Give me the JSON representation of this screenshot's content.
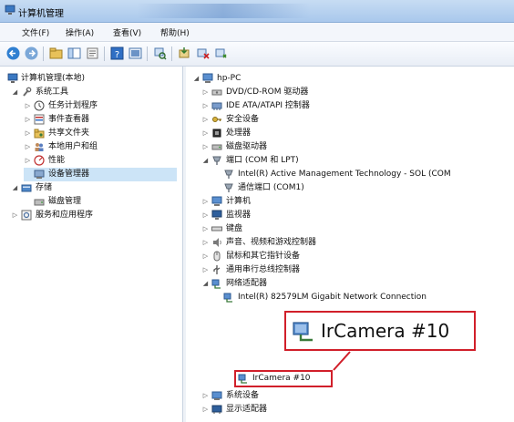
{
  "window": {
    "title": "计算机管理"
  },
  "menu": [
    {
      "label": "文件(F)"
    },
    {
      "label": "操作(A)"
    },
    {
      "label": "查看(V)"
    },
    {
      "label": "帮助(H)"
    }
  ],
  "toolbar": [
    {
      "icon": "back-arrow-icon"
    },
    {
      "icon": "forward-arrow-icon"
    },
    {
      "icon": "up-folder-icon"
    },
    {
      "icon": "show-tree-icon"
    },
    {
      "icon": "properties-icon"
    },
    {
      "icon": "help-icon"
    },
    {
      "icon": "console-icon"
    },
    {
      "icon": "scan-hardware-icon"
    },
    {
      "icon": "update-driver-icon"
    },
    {
      "icon": "disable-device-icon"
    },
    {
      "icon": "uninstall-device-icon"
    }
  ],
  "left_tree": [
    {
      "label": "计算机管理(本地)",
      "expanded": true
    },
    {
      "label": "系统工具",
      "expanded": true
    },
    {
      "label": "任务计划程序"
    },
    {
      "label": "事件查看器"
    },
    {
      "label": "共享文件夹"
    },
    {
      "label": "本地用户和组"
    },
    {
      "label": "性能"
    },
    {
      "label": "设备管理器",
      "selected": true
    },
    {
      "label": "存储",
      "expanded": true
    },
    {
      "label": "磁盘管理"
    },
    {
      "label": "服务和应用程序"
    }
  ],
  "device_tree": [
    {
      "label": "hp-PC",
      "expanded": true
    },
    {
      "label": "DVD/CD-ROM 驱动器"
    },
    {
      "label": "IDE ATA/ATAPI 控制器"
    },
    {
      "label": "安全设备"
    },
    {
      "label": "处理器"
    },
    {
      "label": "磁盘驱动器"
    },
    {
      "label": "端口 (COM 和 LPT)",
      "expanded": true
    },
    {
      "label": "Intel(R) Active Management Technology - SOL (COM"
    },
    {
      "label": "通信端口 (COM1)"
    },
    {
      "label": "计算机"
    },
    {
      "label": "监视器"
    },
    {
      "label": "键盘"
    },
    {
      "label": "声音、视频和游戏控制器"
    },
    {
      "label": "鼠标和其它指针设备"
    },
    {
      "label": "通用串行总线控制器"
    },
    {
      "label": "网络适配器",
      "expanded": true
    },
    {
      "label": "Intel(R) 82579LM Gigabit Network Connection"
    },
    {
      "label": "IrCamera #10",
      "highlighted": true
    },
    {
      "label": "系统设备"
    },
    {
      "label": "显示适配器"
    }
  ],
  "callout": {
    "label": "IrCamera #10"
  },
  "colors": {
    "highlight": "#d11f2a",
    "selection": "#cce4f7",
    "titlebar": "#b7d1f0"
  }
}
